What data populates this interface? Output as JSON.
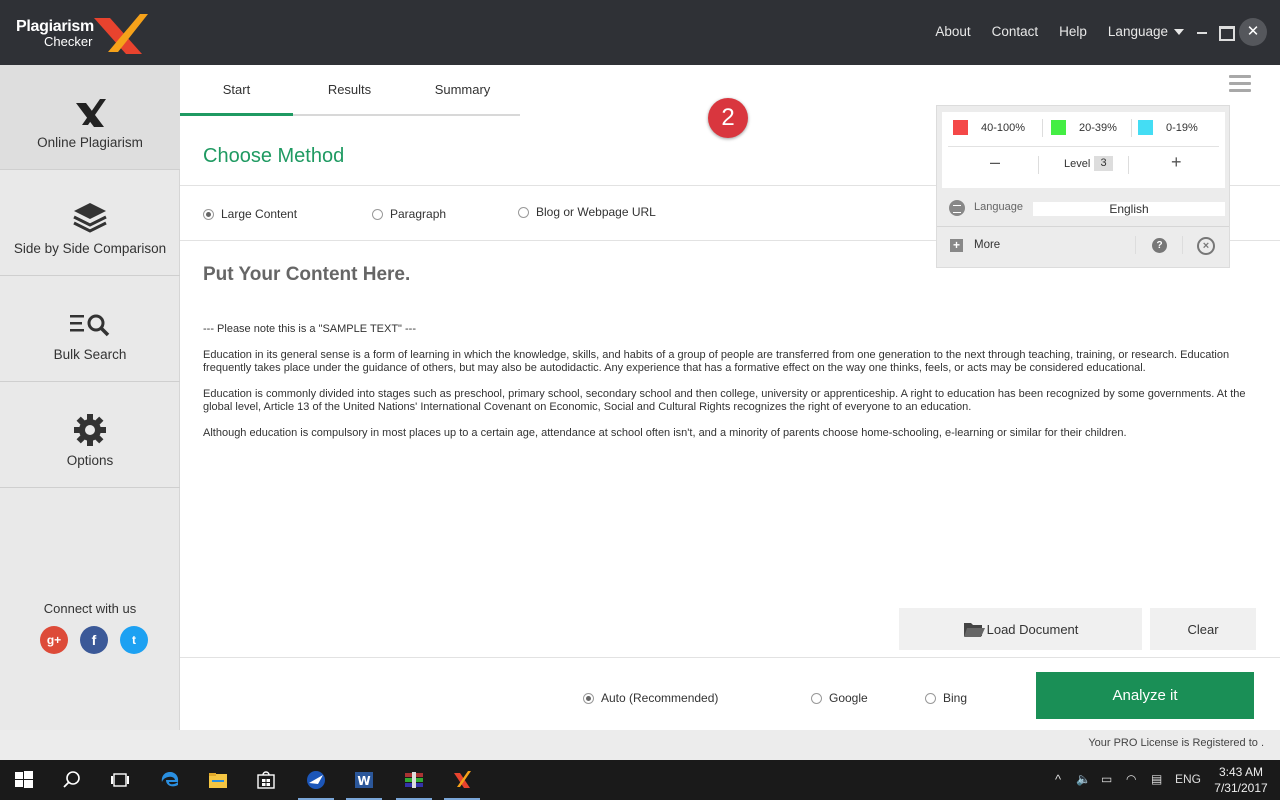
{
  "app": {
    "logo_line1": "Plagiarism",
    "logo_line2": "Checker",
    "accent": "#1f9a62"
  },
  "topnav": {
    "about": "About",
    "contact": "Contact",
    "help": "Help",
    "language": "Language"
  },
  "sidebar": {
    "items": [
      {
        "label": "Online Plagiarism",
        "icon": "x-logo-icon"
      },
      {
        "label": "Side by Side Comparison",
        "icon": "layers-icon"
      },
      {
        "label": "Bulk Search",
        "icon": "list-search-icon"
      },
      {
        "label": "Options",
        "icon": "gear-icon"
      }
    ],
    "connect_label": "Connect with us",
    "social": {
      "google": "g+",
      "facebook": "f",
      "twitter": "t"
    }
  },
  "tabs": [
    "Start",
    "Results",
    "Summary"
  ],
  "step_badge": "2",
  "main": {
    "section_title": "Choose Method",
    "methods": [
      "Large Content",
      "Paragraph",
      "Blog or Webpage URL"
    ],
    "content_title": "Put Your Content Here.",
    "content_paragraphs": [
      "--- Please note this is a \"SAMPLE TEXT\" ---",
      "Education in its general sense is a form of learning in which the knowledge, skills, and habits of a group of people are transferred from one generation to the next through teaching, training, or research. Education frequently takes place under the guidance of others, but may also be autodidactic. Any experience that has a formative effect on the way one thinks, feels, or acts may be considered educational.",
      "Education is commonly divided into stages such as preschool, primary school, secondary school and then college, university or apprenticeship. A right to education has been recognized by some governments. At the global level, Article 13 of the United Nations' International Covenant on Economic, Social and Cultural Rights recognizes the right of everyone to an education.",
      "Although education is compulsory in most places up to a certain age, attendance at school often isn't, and a minority of parents choose home-schooling, e-learning or similar for their children."
    ],
    "load_button": "Load Document",
    "clear_button": "Clear",
    "engines": [
      "Auto (Recommended)",
      "Google",
      "Bing"
    ],
    "analyze_button": "Analyze it"
  },
  "panel": {
    "legend": [
      {
        "label": "40-100%",
        "color": "#f44848"
      },
      {
        "label": "20-39%",
        "color": "#44ee44"
      },
      {
        "label": "0-19%",
        "color": "#44ddf4"
      }
    ],
    "minus": "–",
    "plus": "+",
    "level_label": "Level",
    "level_value": "3",
    "language_label": "Language",
    "language_value": "English",
    "more_label": "More",
    "help": "?",
    "close": "×"
  },
  "status": {
    "license": "Your PRO License is Registered to ."
  },
  "taskbar": {
    "lang": "ENG",
    "time": "3:43 AM",
    "date": "7/31/2017"
  }
}
